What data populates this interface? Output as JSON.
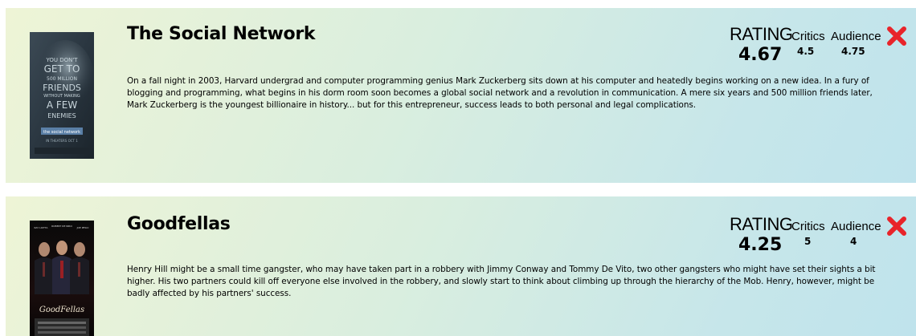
{
  "movies": [
    {
      "title": "The Social Network",
      "description": "On a fall night in 2003, Harvard undergrad and computer programming genius Mark Zuckerberg sits down at his computer and heatedly begins working on a new idea. In a fury of blogging and programming, what begins in his dorm room soon becomes a global social network and a revolution in communication. A mere six years and 500 million friends later, Mark Zuckerberg is the youngest billionaire in history... but for this entrepreneur, success leads to both personal and legal complications.",
      "rating_label": "RATING",
      "critics_label": "Critics",
      "audience_label": "Audience",
      "overall_rating": "4.67",
      "critics_rating": "4.5",
      "audience_rating": "4.75",
      "poster": {
        "tagline_lines": [
          "YOU DON'T",
          "GET TO",
          "500 MILLION",
          "FRIENDS",
          "WITHOUT MAKING",
          "A FEW",
          "ENEMIES"
        ],
        "logo": "the social network",
        "date": "IN THEATERS OCT 1"
      }
    },
    {
      "title": "Goodfellas",
      "description": "Henry Hill might be a small time gangster, who may have taken part in a robbery with Jimmy Conway and Tommy De Vito, two other gangsters who might have set their sights a bit higher. His two partners could kill off everyone else involved in the robbery, and slowly start to think about climbing up through the hierarchy of the Mob. Henry, however, might be badly affected by his partners' success.",
      "rating_label": "RATING",
      "critics_label": "Critics",
      "audience_label": "Audience",
      "overall_rating": "4.25",
      "critics_rating": "5",
      "audience_rating": "4",
      "poster": {
        "actors": [
          "RAY LIOTTA",
          "ROBERT DE NIRO",
          "JOE PESCI"
        ],
        "logo": "GoodFellas"
      }
    }
  ],
  "colors": {
    "close_icon": "#e8242a",
    "card_gradient_start": "#eef4d6",
    "card_gradient_end": "#bfe3ec"
  }
}
